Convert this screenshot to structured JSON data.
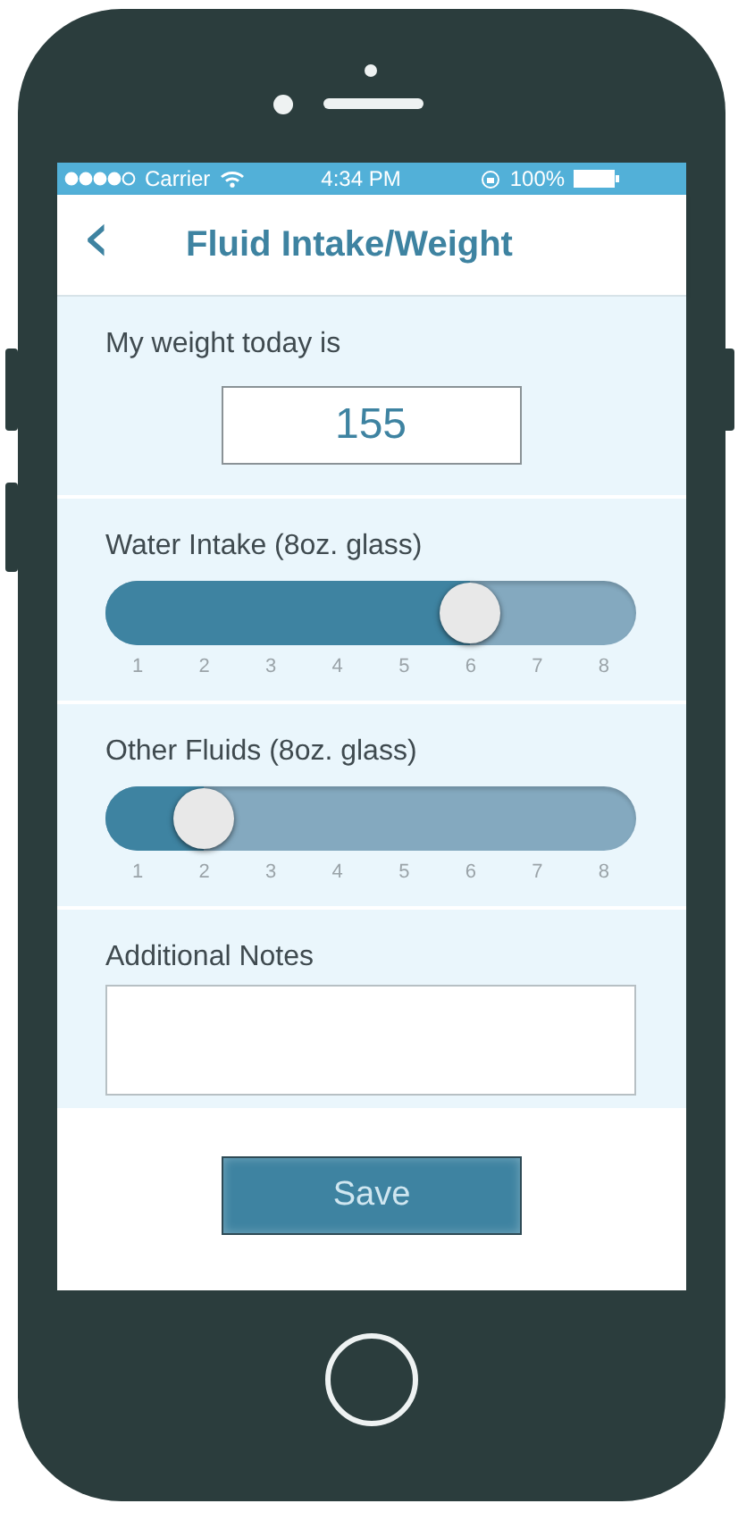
{
  "status_bar": {
    "carrier": "Carrier",
    "time": "4:34 PM",
    "battery": "100%"
  },
  "header": {
    "back": "‹",
    "title": "Fluid Intake/Weight"
  },
  "weight": {
    "label": "My weight today is",
    "value": "155"
  },
  "sliders": [
    {
      "label": "Water Intake (8oz. glass)",
      "level": 0.714,
      "ticks": [
        "1",
        "2",
        "3",
        "4",
        "5",
        "6",
        "7",
        "8"
      ]
    },
    {
      "label": "Other Fluids (8oz. glass)",
      "level": 0.143,
      "ticks": [
        "1",
        "2",
        "3",
        "4",
        "5",
        "6",
        "7",
        "8"
      ]
    }
  ],
  "notes": {
    "label": "Additional Notes"
  },
  "buttons": [
    "Save"
  ]
}
